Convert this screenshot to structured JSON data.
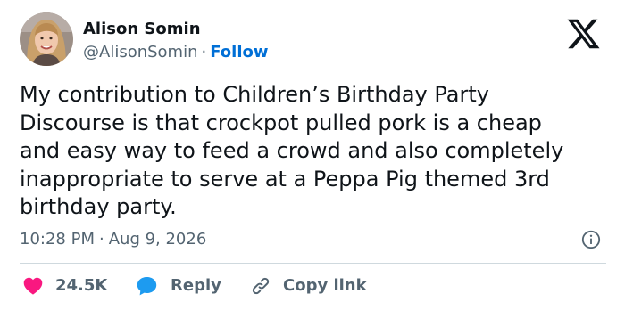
{
  "author": {
    "name": "Alison Somin",
    "handle": "@AlisonSomin",
    "separator": "·",
    "follow_label": "Follow"
  },
  "tweet": {
    "text": "My contribution to Children’s Birthday Party\nDiscourse is that crockpot pulled pork is a cheap\nand easy way to feed a crowd and also completely\ninappropriate to serve at a Peppa Pig themed 3rd\nbirthday party.",
    "time": "10:28 PM",
    "date": "Aug 9, 2026"
  },
  "actions": {
    "likes_count": "24.5K",
    "reply_label": "Reply",
    "copy_link_label": "Copy link"
  },
  "icons": {
    "logo": "x-logo-icon",
    "info": "info-icon",
    "like": "heart-icon",
    "reply": "speech-bubble-icon",
    "copy": "link-icon"
  },
  "colors": {
    "accent": "#006fd6",
    "like": "#f91880",
    "reply": "#1d9bf0",
    "text": "#0f1419",
    "muted": "#536471",
    "divider": "#cfd9de"
  }
}
